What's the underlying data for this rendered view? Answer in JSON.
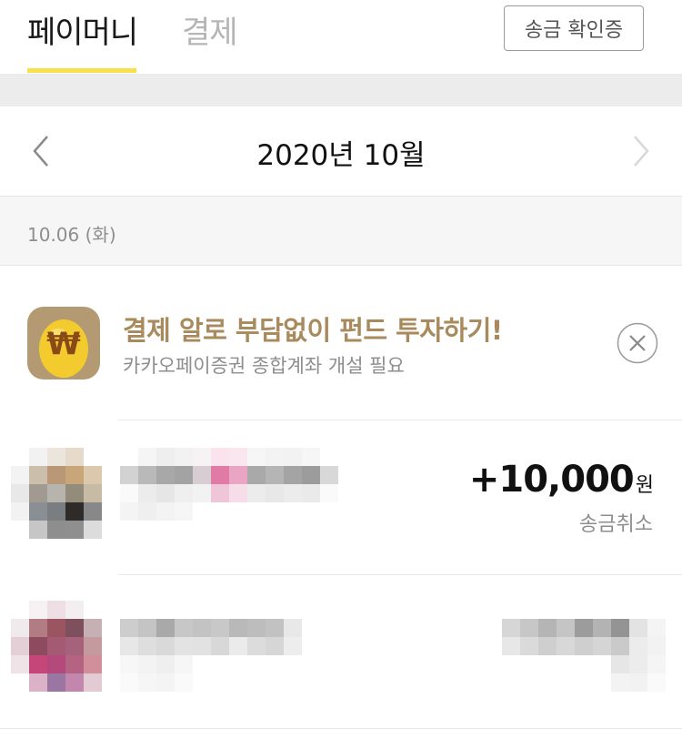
{
  "tabs": [
    {
      "label": "페이머니",
      "active": true
    },
    {
      "label": "결제",
      "active": false
    }
  ],
  "receipt_button_label": "송금 확인증",
  "month_nav": {
    "title": "2020년 10월"
  },
  "date_header": "10.06 (화)",
  "promo": {
    "title": "결제 알로 부담없이 펀드 투자하기!",
    "subtitle": "카카오페이증권 종합계좌 개설 필요",
    "icon_symbol": "₩"
  },
  "transactions": [
    {
      "amount": "+10,000",
      "unit": "원",
      "status": "송금취소"
    }
  ],
  "colors": {
    "accent_yellow": "#f7e04a",
    "promo_gold": "#a88a5c",
    "text_gray": "#8e8e8e"
  }
}
